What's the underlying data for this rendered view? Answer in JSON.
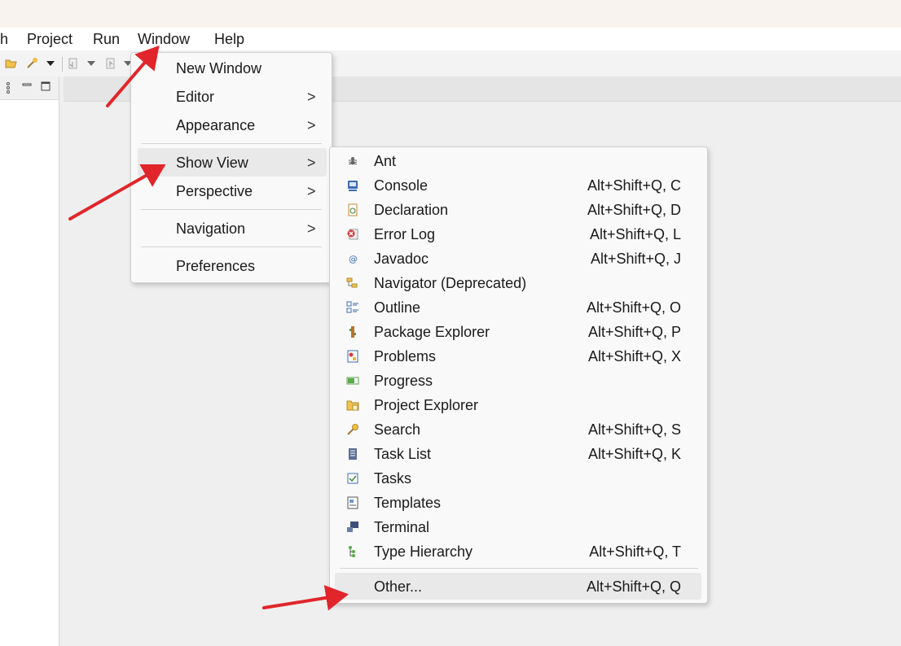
{
  "menubar": {
    "items": [
      "h",
      "Project",
      "Run",
      "Window",
      "Help"
    ]
  },
  "window_menu": {
    "items": [
      {
        "label": "New Window",
        "has_submenu": false
      },
      {
        "label": "Editor",
        "has_submenu": true
      },
      {
        "label": "Appearance",
        "has_submenu": true
      },
      {
        "label": "Show View",
        "has_submenu": true,
        "highlighted": true
      },
      {
        "label": "Perspective",
        "has_submenu": true
      },
      {
        "label": "Navigation",
        "has_submenu": true
      },
      {
        "label": "Preferences",
        "has_submenu": false
      }
    ],
    "chevron": ">"
  },
  "show_view_menu": {
    "items": [
      {
        "label": "Ant",
        "shortcut": "",
        "icon": "ant-icon"
      },
      {
        "label": "Console",
        "shortcut": "Alt+Shift+Q, C",
        "icon": "console-icon"
      },
      {
        "label": "Declaration",
        "shortcut": "Alt+Shift+Q, D",
        "icon": "declaration-icon"
      },
      {
        "label": "Error Log",
        "shortcut": "Alt+Shift+Q, L",
        "icon": "error-log-icon"
      },
      {
        "label": "Javadoc",
        "shortcut": "Alt+Shift+Q, J",
        "icon": "javadoc-icon"
      },
      {
        "label": "Navigator (Deprecated)",
        "shortcut": "",
        "icon": "navigator-icon"
      },
      {
        "label": "Outline",
        "shortcut": "Alt+Shift+Q, O",
        "icon": "outline-icon"
      },
      {
        "label": "Package Explorer",
        "shortcut": "Alt+Shift+Q, P",
        "icon": "package-explorer-icon"
      },
      {
        "label": "Problems",
        "shortcut": "Alt+Shift+Q, X",
        "icon": "problems-icon"
      },
      {
        "label": "Progress",
        "shortcut": "",
        "icon": "progress-icon"
      },
      {
        "label": "Project Explorer",
        "shortcut": "",
        "icon": "project-explorer-icon"
      },
      {
        "label": "Search",
        "shortcut": "Alt+Shift+Q, S",
        "icon": "search-icon"
      },
      {
        "label": "Task List",
        "shortcut": "Alt+Shift+Q, K",
        "icon": "task-list-icon"
      },
      {
        "label": "Tasks",
        "shortcut": "",
        "icon": "tasks-icon"
      },
      {
        "label": "Templates",
        "shortcut": "",
        "icon": "templates-icon"
      },
      {
        "label": "Terminal",
        "shortcut": "",
        "icon": "terminal-icon"
      },
      {
        "label": "Type Hierarchy",
        "shortcut": "Alt+Shift+Q, T",
        "icon": "type-hierarchy-icon"
      }
    ],
    "other": {
      "label": "Other...",
      "shortcut": "Alt+Shift+Q, Q"
    }
  },
  "colors": {
    "annotation_arrow": "#e0262b",
    "menu_background": "#f9f9f9",
    "highlight": "#e9e9e9"
  }
}
